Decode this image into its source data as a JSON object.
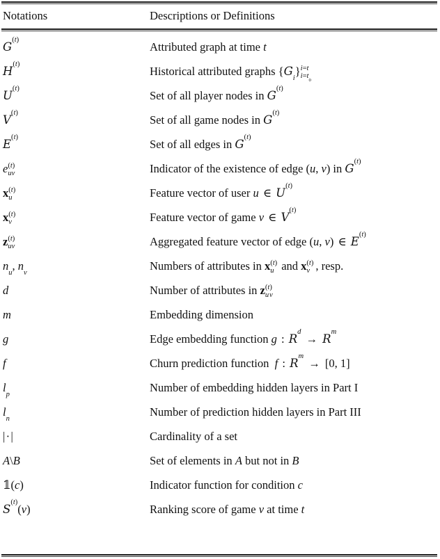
{
  "table": {
    "headers": {
      "notations": "Notations",
      "descriptions": "Descriptions or Definitions"
    },
    "rows": [
      {
        "notation_plain": "G^(t)",
        "description_plain": "Attributed graph at time t"
      },
      {
        "notation_plain": "H^(t)",
        "description_plain": "Historical attributed graphs {G_i}_{i=t0}^{i=t}"
      },
      {
        "notation_plain": "U^(t)",
        "description_plain": "Set of all player nodes in G^(t)"
      },
      {
        "notation_plain": "V^(t)",
        "description_plain": "Set of all game nodes in G^(t)"
      },
      {
        "notation_plain": "E^(t)",
        "description_plain": "Set of all edges in G^(t)"
      },
      {
        "notation_plain": "e^(t)_uv",
        "description_plain": "Indicator of the existence of edge (u, v) in G^(t)"
      },
      {
        "notation_plain": "x^(t)_u",
        "description_plain": "Feature vector of user u ∈ U^(t)"
      },
      {
        "notation_plain": "x^(t)_v",
        "description_plain": "Feature vector of game v ∈ V^(t)"
      },
      {
        "notation_plain": "z^(t)_uv",
        "description_plain": "Aggregated feature vector of edge (u, v) ∈ E^(t)"
      },
      {
        "notation_plain": "n_u, n_v",
        "description_plain": "Numbers of attributes in x^(t)_u and x^(t)_v, resp."
      },
      {
        "notation_plain": "d",
        "description_plain": "Number of attributes in z^(t)_uv"
      },
      {
        "notation_plain": "m",
        "description_plain": "Embedding dimension"
      },
      {
        "notation_plain": "g",
        "description_plain": "Edge embedding function g : R^d → R^m"
      },
      {
        "notation_plain": "f",
        "description_plain": "Churn prediction function f : R^m → [0, 1]"
      },
      {
        "notation_plain": "l_p",
        "description_plain": "Number of embedding hidden layers in Part I"
      },
      {
        "notation_plain": "l_n",
        "description_plain": "Number of prediction hidden layers in Part III"
      },
      {
        "notation_plain": "| · |",
        "description_plain": "Cardinality of a set"
      },
      {
        "notation_plain": "A\\B",
        "description_plain": "Set of elements in A but not in B"
      },
      {
        "notation_plain": "1(c)",
        "description_plain": "Indicator function for condition c"
      },
      {
        "notation_plain": "S^(t)(v)",
        "description_plain": "Ranking score of game v at time t"
      }
    ]
  },
  "style": {
    "rule_color": "#1a1a1a",
    "text_color": "#111111",
    "background": "#ffffff"
  }
}
